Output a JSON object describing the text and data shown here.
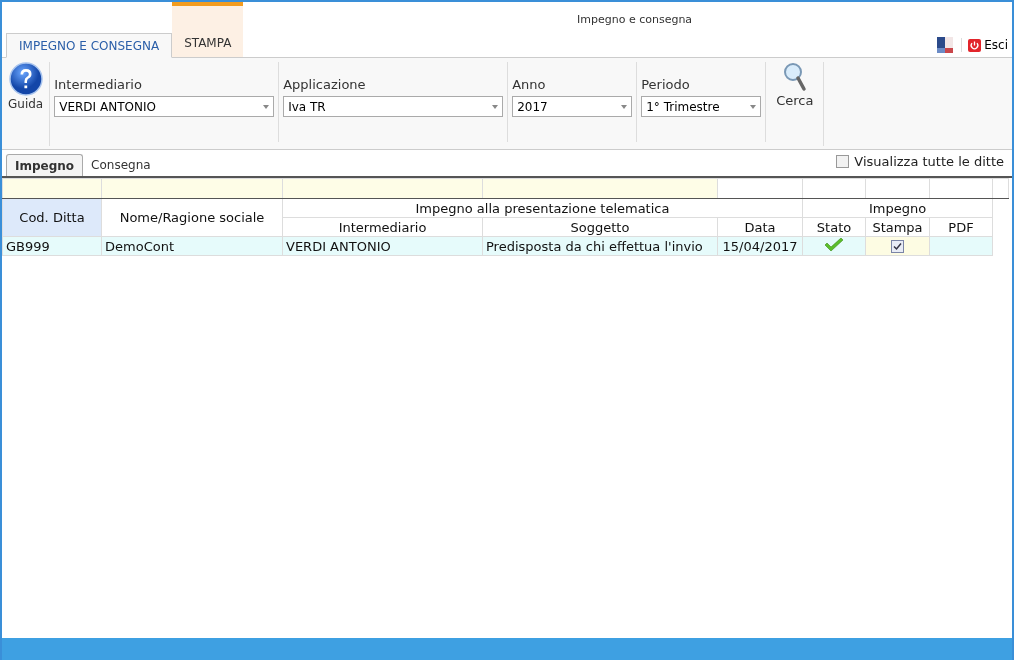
{
  "window": {
    "title": "Impegno e consegna"
  },
  "ribbon_tabs": [
    {
      "label": "IMPEGNO E CONSEGNA",
      "selected": true
    },
    {
      "label": "STAMPA",
      "selected": false
    }
  ],
  "exit_button": {
    "label": "Esci"
  },
  "ribbon": {
    "help_button": "Guida",
    "fields": [
      {
        "label": "Intermediario",
        "value": "VERDI ANTONIO"
      },
      {
        "label": "Applicazione",
        "value": "Iva TR"
      },
      {
        "label": "Anno",
        "value": "2017"
      },
      {
        "label": "Periodo",
        "value": "1° Trimestre"
      }
    ],
    "search_button": "Cerca"
  },
  "sub_tabs": [
    {
      "label": "Impegno",
      "selected": true
    },
    {
      "label": "Consegna",
      "selected": false
    }
  ],
  "show_all": {
    "label": "Visualizza tutte le ditte",
    "checked": false
  },
  "table": {
    "group_headers": [
      "Impegno alla presentazione telematica",
      "Impegno"
    ],
    "columns": [
      "Cod. Ditta",
      "Nome/Ragione sociale",
      "Intermediario",
      "Soggetto",
      "Data",
      "Stato",
      "Stampa",
      "PDF"
    ],
    "rows": [
      {
        "cod": "GB999",
        "nome": "DemoCont",
        "intermediario": "VERDI ANTONIO",
        "soggetto": "Predisposta da chi effettua l'invio",
        "data": "15/04/2017",
        "stato_ok": true,
        "stampa": true,
        "selected": true
      }
    ]
  }
}
